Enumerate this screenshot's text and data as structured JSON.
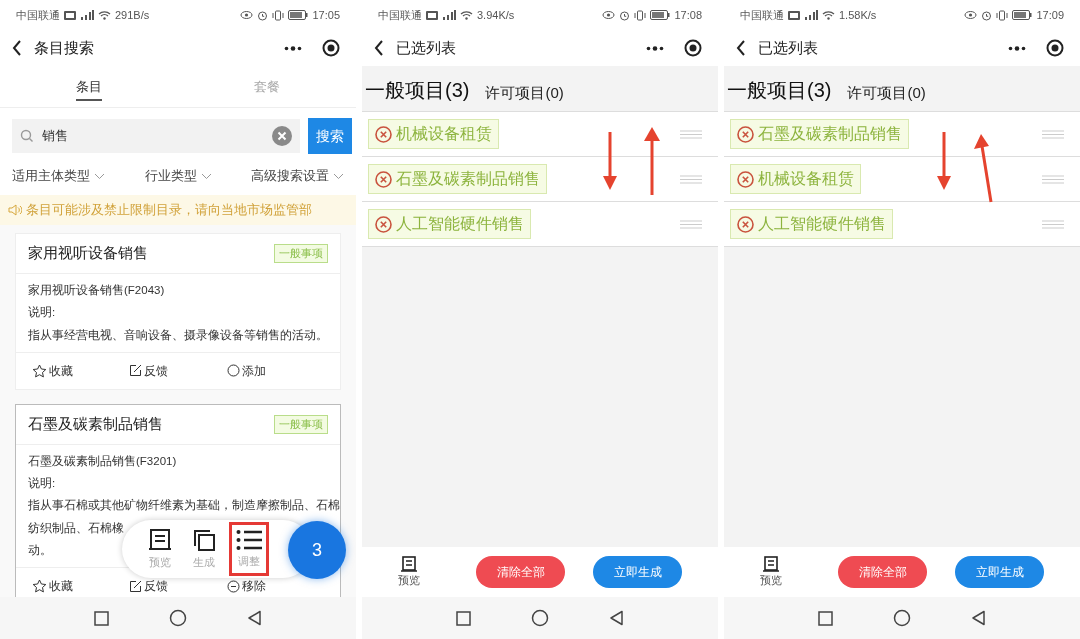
{
  "screens": [
    {
      "kind": "search",
      "status_bar": {
        "carrier": "中国联通",
        "speed": "291B/s",
        "time": "17:05"
      },
      "title": "条目搜索",
      "tabs": [
        {
          "label": "条目",
          "selected": true
        },
        {
          "label": "套餐",
          "selected": false
        }
      ],
      "search": {
        "value": "销售",
        "button": "搜索"
      },
      "filters": [
        "适用主体类型",
        "行业类型",
        "高级搜索设置"
      ],
      "notice": "条目可能涉及禁止限制目录，请向当地市场监管部",
      "cards": [
        {
          "title": "家用视听设备销售",
          "tag": "一般事项",
          "code": "家用视听设备销售(F2043)",
          "label": "说明:",
          "description": [
            "指从事经营电视、音响设备、摄录像设备等销售的活动。"
          ],
          "actions": [
            {
              "kind": "star",
              "label": "收藏"
            },
            {
              "kind": "edit",
              "label": "反馈"
            },
            {
              "kind": "add",
              "label": "添加"
            }
          ]
        },
        {
          "title": "石墨及碳素制品销售",
          "tag": "一般事项",
          "code": "石墨及碳素制品销售(F3201)",
          "label": "说明:",
          "description": [
            "指从事石棉或其他矿物纤维素为基础，制造摩擦制品、石棉",
            "纺织制品、石棉橡",
            "动。"
          ],
          "actions": [
            {
              "kind": "star",
              "label": "收藏"
            },
            {
              "kind": "edit",
              "label": "反馈"
            },
            {
              "kind": "remove",
              "label": "移除"
            }
          ]
        }
      ],
      "float_bar": {
        "items": [
          {
            "kind": "preview",
            "label": "预览",
            "highlighted": false
          },
          {
            "kind": "generate",
            "label": "生成",
            "highlighted": false
          },
          {
            "kind": "adjust",
            "label": "调整",
            "highlighted": true
          }
        ],
        "count": "3"
      }
    },
    {
      "kind": "list",
      "status_bar": {
        "carrier": "中国联通",
        "speed": "3.94K/s",
        "time": "17:08"
      },
      "title": "已选列表",
      "categories": [
        {
          "label": "一般项目(3)",
          "selected": true
        },
        {
          "label": "许可项目(0)",
          "selected": false
        }
      ],
      "items": [
        "机械设备租赁",
        "石墨及碳素制品销售",
        "人工智能硬件销售"
      ],
      "bottom": {
        "preview": "预览",
        "buttons": [
          {
            "kind": "danger",
            "label": "清除全部"
          },
          {
            "kind": "primary",
            "label": "立即生成"
          }
        ]
      }
    },
    {
      "kind": "list",
      "status_bar": {
        "carrier": "中国联通",
        "speed": "1.58K/s",
        "time": "17:09"
      },
      "title": "已选列表",
      "categories": [
        {
          "label": "一般项目(3)",
          "selected": true
        },
        {
          "label": "许可项目(0)",
          "selected": false
        }
      ],
      "items": [
        "石墨及碳素制品销售",
        "机械设备租赁",
        "人工智能硬件销售"
      ],
      "bottom": {
        "preview": "预览",
        "buttons": [
          {
            "kind": "danger",
            "label": "清除全部"
          },
          {
            "kind": "primary",
            "label": "立即生成"
          }
        ]
      }
    }
  ]
}
